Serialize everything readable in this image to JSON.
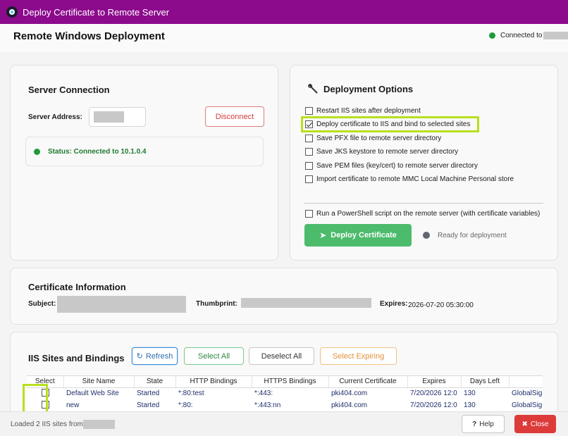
{
  "window": {
    "title": "Deploy Certificate to Remote Server"
  },
  "header": {
    "page_title": "Remote Windows Deployment",
    "connection_label": "Connected to"
  },
  "server_connection": {
    "title": "Server Connection",
    "address_label": "Server Address:",
    "disconnect_label": "Disconnect",
    "status_text": "Status: Connected to 10.1.0.4"
  },
  "deployment_options": {
    "title": "Deployment Options",
    "options": [
      {
        "label": "Restart IIS sites after deployment",
        "checked": false
      },
      {
        "label": "Deploy certificate to IIS and bind to selected sites",
        "checked": true
      },
      {
        "label": "Save PFX file to remote server directory",
        "checked": false
      },
      {
        "label": "Save JKS keystore to remote server directory",
        "checked": false
      },
      {
        "label": "Save PEM files (key/cert) to remote server directory",
        "checked": false
      },
      {
        "label": "Import certificate to remote MMC Local Machine Personal store",
        "checked": false
      }
    ],
    "powershell_label": "Run a PowerShell script on the remote server (with certificate variables)",
    "deploy_button": "Deploy Certificate",
    "ready_text": "Ready for deployment"
  },
  "certificate_info": {
    "title": "Certificate Information",
    "subject_label": "Subject:",
    "thumbprint_label": "Thumbprint:",
    "expires_label": "Expires:",
    "expires_value": "2026-07-20 05:30:00"
  },
  "iis_sites": {
    "title": "IIS Sites and Bindings",
    "refresh": "Refresh",
    "select_all": "Select All",
    "deselect_all": "Deselect All",
    "select_expiring": "Select Expiring",
    "columns": [
      "Select",
      "Site Name",
      "State",
      "HTTP Bindings",
      "HTTPS Bindings",
      "Current Certificate",
      "Expires",
      "Days Left",
      ""
    ],
    "rows": [
      {
        "site": "Default Web Site",
        "state": "Started",
        "http": "*:80:test",
        "https": "*:443:",
        "cert": "pki404.com",
        "expires": "7/20/2026 12:0",
        "days": "130",
        "issuer": "GlobalSig"
      },
      {
        "site": "new",
        "state": "Started",
        "http": "*:80:",
        "https": "*:443:nn",
        "cert": "pki404.com",
        "expires": "7/20/2026 12:0",
        "days": "130",
        "issuer": "GlobalSig"
      }
    ]
  },
  "footer": {
    "status": "Loaded 2 IIS sites from",
    "help": "Help",
    "close": "Close"
  },
  "colors": {
    "title_bar": "#8c0a8c",
    "accent_green": "#4cbb6c",
    "danger": "#dd3a3a",
    "highlight": "#b8e01e"
  }
}
